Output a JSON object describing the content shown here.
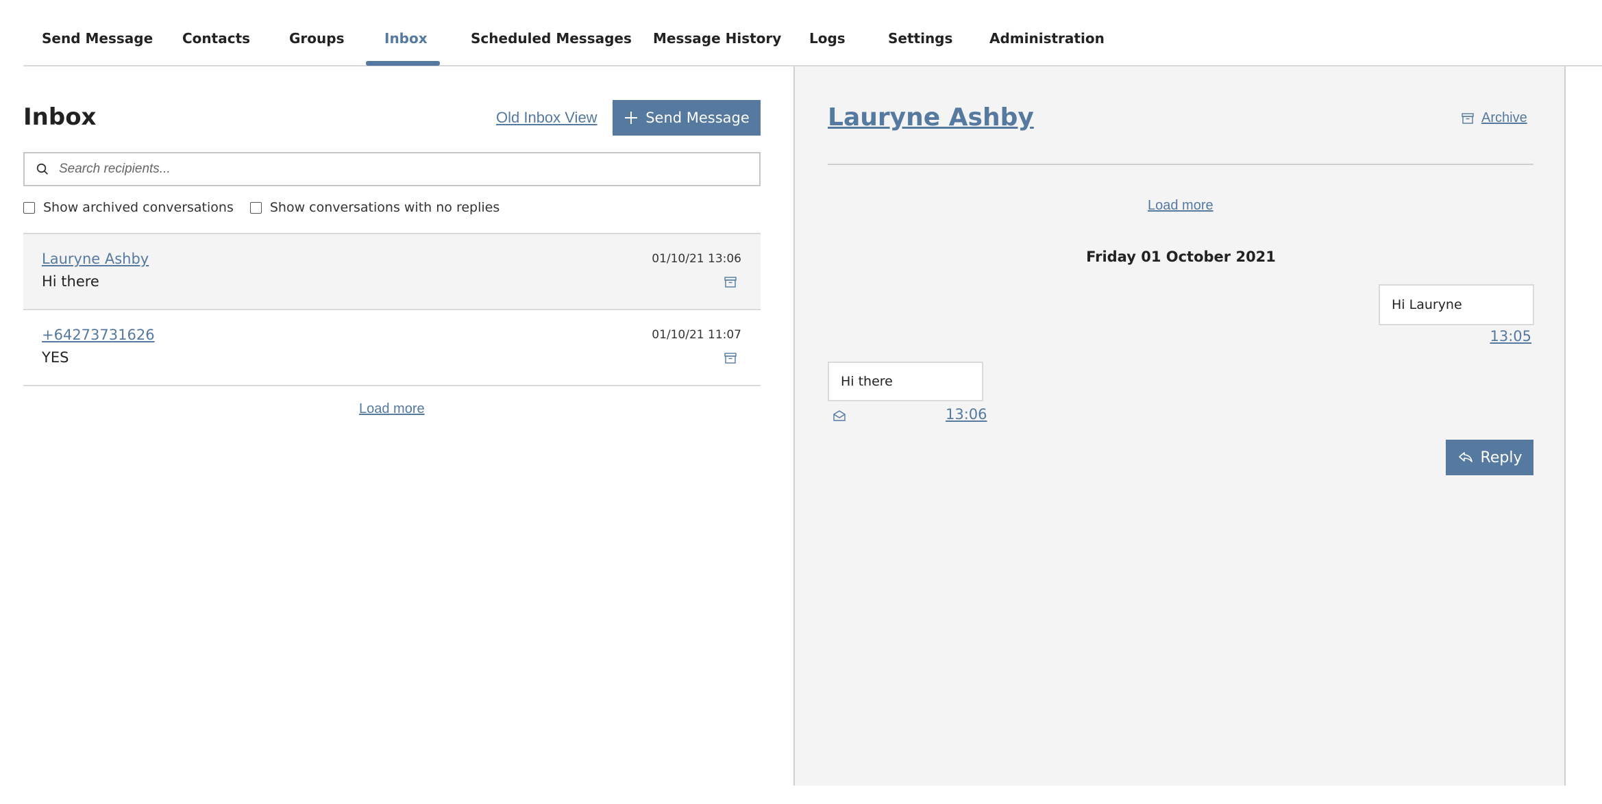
{
  "nav": {
    "tabs": [
      {
        "label": "Send Message"
      },
      {
        "label": "Contacts"
      },
      {
        "label": "Groups"
      },
      {
        "label": "Inbox"
      },
      {
        "label": "Scheduled Messages"
      },
      {
        "label": "Message History"
      },
      {
        "label": "Logs"
      },
      {
        "label": "Settings"
      },
      {
        "label": "Administration"
      }
    ],
    "active_tab": "Inbox"
  },
  "inbox": {
    "title": "Inbox",
    "old_view_label": "Old Inbox View",
    "send_button_label": "Send Message",
    "search": {
      "placeholder": "Search recipients...",
      "value": ""
    },
    "filters": {
      "archived_label": "Show archived conversations",
      "archived_checked": false,
      "no_replies_label": "Show conversations with no replies",
      "no_replies_checked": false
    },
    "conversations": [
      {
        "name": "Lauryne Ashby",
        "message": "Hi there",
        "time": "01/10/21 13:06",
        "selected": true
      },
      {
        "name": "+64273731626",
        "message": "YES",
        "time": "01/10/21 11:07",
        "selected": false
      }
    ],
    "load_more_label": "Load more"
  },
  "conversation": {
    "contact_name": "Lauryne Ashby",
    "archive_label": "Archive",
    "load_more_label": "Load more",
    "date_heading": "Friday 01 October 2021",
    "messages": [
      {
        "direction": "outgoing",
        "text": "Hi Lauryne",
        "time": "13:05"
      },
      {
        "direction": "incoming",
        "text": "Hi there",
        "time": "13:06",
        "status_icon": "envelope-open-icon"
      }
    ],
    "reply_label": "Reply"
  },
  "colors": {
    "accent": "#55799f",
    "panel_background": "#f4f4f4",
    "border": "#d9d9d9"
  },
  "icons": {
    "send_button": "plus-icon",
    "search": "search-icon",
    "archive": "archive-box-icon",
    "reply": "reply-arrow-icon"
  }
}
